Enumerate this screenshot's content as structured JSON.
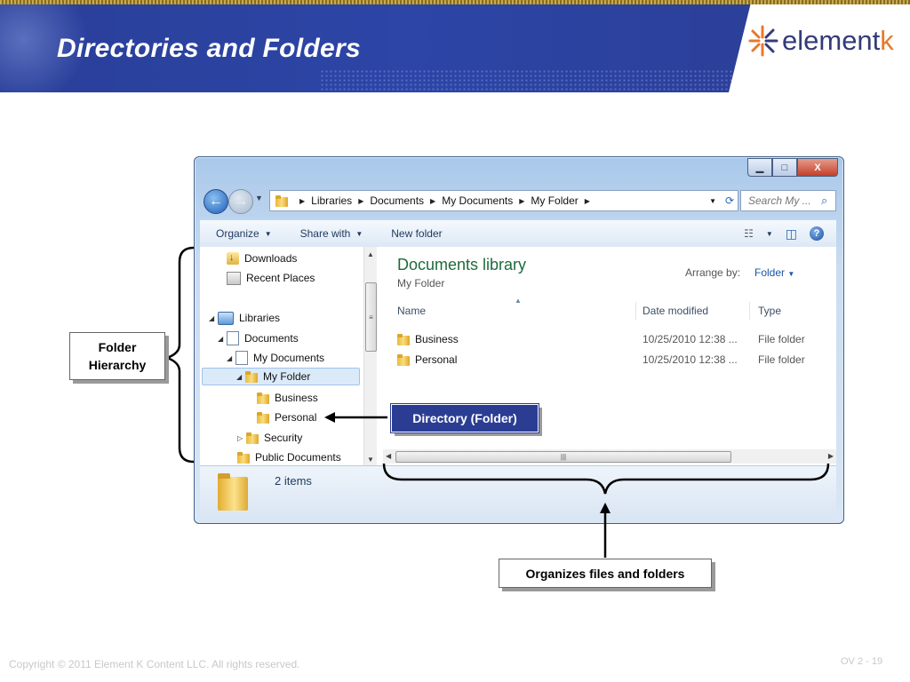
{
  "slide": {
    "title": "Directories and Folders",
    "logo": "elementk",
    "logo_main": "element",
    "logo_accent": "k",
    "footer_copyright": "Copyright © 2011 Element K Content LLC. All rights reserved.",
    "page_number": "OV 2 - 19"
  },
  "window": {
    "controls": {
      "minimize": "▁",
      "maximize": "□",
      "close": "X"
    },
    "address_bar": {
      "breadcrumbs": [
        "Libraries",
        "Documents",
        "My Documents",
        "My Folder"
      ]
    },
    "search": {
      "placeholder": "Search My ..."
    },
    "toolbar": {
      "organize": "Organize",
      "share_with": "Share with",
      "new_folder": "New folder"
    },
    "nav_pane": {
      "items": [
        {
          "label": "Downloads",
          "icon": "downloads-icon"
        },
        {
          "label": "Recent Places",
          "icon": "recent-places-icon"
        },
        {
          "label": "Libraries",
          "icon": "libraries-icon"
        },
        {
          "label": "Documents",
          "icon": "documents-icon"
        },
        {
          "label": "My Documents",
          "icon": "documents-icon"
        },
        {
          "label": "My Folder",
          "icon": "folder-icon",
          "selected": true
        },
        {
          "label": "Business",
          "icon": "folder-icon"
        },
        {
          "label": "Personal",
          "icon": "folder-icon"
        },
        {
          "label": "Security",
          "icon": "folder-icon"
        },
        {
          "label": "Public Documents",
          "icon": "folder-icon"
        }
      ]
    },
    "content": {
      "library_title": "Documents library",
      "library_subtitle": "My Folder",
      "arrange_by_label": "Arrange by:",
      "arrange_by_value": "Folder",
      "columns": [
        "Name",
        "Date modified",
        "Type"
      ],
      "rows": [
        {
          "name": "Business",
          "date": "10/25/2010 12:38 ...",
          "type": "File folder"
        },
        {
          "name": "Personal",
          "date": "10/25/2010 12:38 ...",
          "type": "File folder"
        }
      ]
    },
    "details": {
      "item_count": "2 items"
    }
  },
  "annotations": {
    "folder_hierarchy": "Folder Hierarchy",
    "directory_folder": "Directory (Folder)",
    "organizes": "Organizes files and folders"
  },
  "colors": {
    "header_blue": "#2b3d93",
    "library_title_green": "#1e6b3b",
    "logo_orange": "#e8792b"
  }
}
